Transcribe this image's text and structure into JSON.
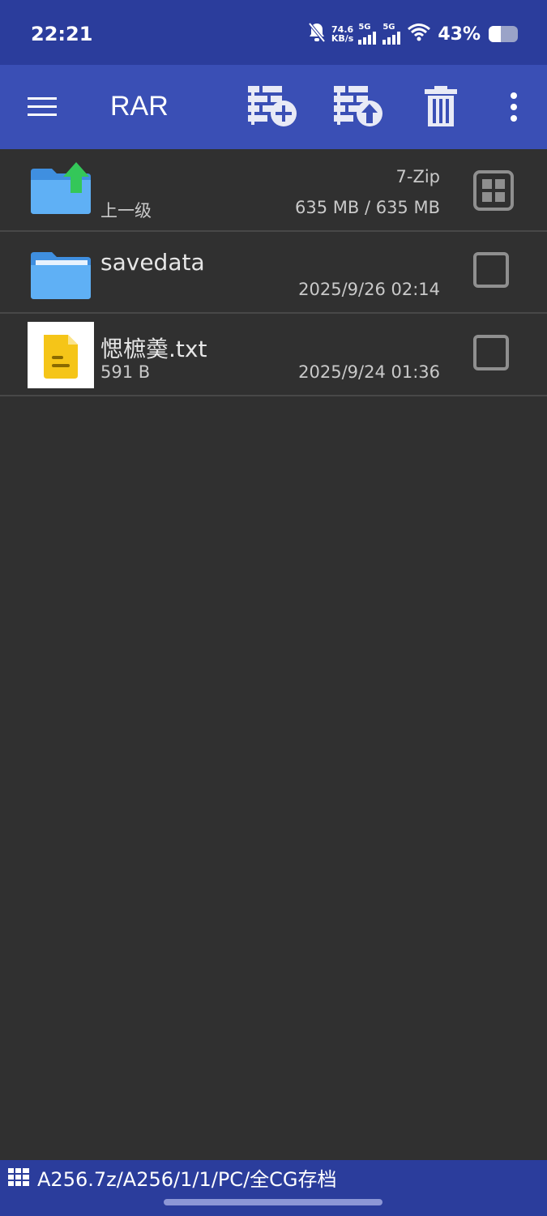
{
  "status_bar": {
    "time": "22:21",
    "speed_value": "74.6",
    "speed_unit": "KB/s",
    "sim1": "5G",
    "sim2": "5G",
    "battery_percent_text": "43%",
    "battery_level": 0.43
  },
  "toolbar": {
    "title": "RAR"
  },
  "files": [
    {
      "name": "",
      "subtitle": "上一级",
      "top_right": "7-Zip",
      "bottom_right": "635 MB / 635 MB"
    },
    {
      "name": "savedata",
      "subtitle": "",
      "top_right": "",
      "bottom_right": "2025/9/26 02:14"
    },
    {
      "name": "愢樜羮.txt",
      "subtitle": "591 B",
      "top_right": "",
      "bottom_right": "2025/9/24 01:36"
    }
  ],
  "path_bar": {
    "path": "A256.7z/A256/1/1/PC/全CG存档"
  },
  "colors": {
    "status_bar": "#2b3d9c",
    "toolbar": "#3a4fb5",
    "background": "#303030",
    "folder": "#4aa3f0",
    "up_arrow": "#34c759",
    "txt_icon": "#f5c518"
  },
  "icons": {
    "menu": "hamburger-menu-icon",
    "add_to_archive": "archive-add-icon",
    "extract": "archive-extract-icon",
    "delete": "trash-icon",
    "more": "more-vert-icon",
    "select_all": "grid-select-icon",
    "parent_folder": "folder-up-icon",
    "folder": "folder-icon",
    "text_file": "text-file-icon",
    "path": "path-grid-icon"
  }
}
